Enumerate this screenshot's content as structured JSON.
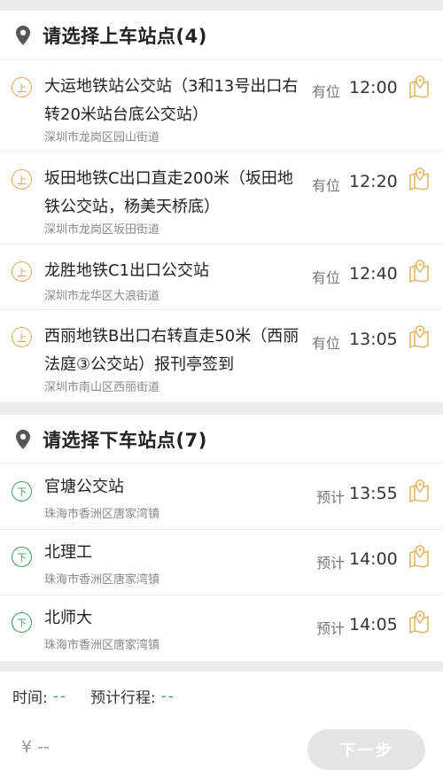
{
  "colors": {
    "accent_green": "#3aa060",
    "pickup_badge": "#d99a45",
    "map_icon": "#e0b868"
  },
  "pickup": {
    "title": "请选择上车站点(4)",
    "stops": [
      {
        "badge": "上",
        "name": "大运地铁站公交站（3和13号出口右转20米站台底公交站）",
        "address": "深圳市龙岗区园山街道",
        "tag": "有位",
        "time": "12:00"
      },
      {
        "badge": "上",
        "name": "坂田地铁C出口直走200米（坂田地铁公交站，杨美天桥底）",
        "address": "深圳市龙岗区坂田街道",
        "tag": "有位",
        "time": "12:20"
      },
      {
        "badge": "上",
        "name": "龙胜地铁C1出口公交站",
        "address": "深圳市龙华区大浪街道",
        "tag": "有位",
        "time": "12:40"
      },
      {
        "badge": "上",
        "name": "西丽地铁B出口右转直走50米（西丽法庭③公交站）报刊亭签到",
        "address": "深圳市南山区西丽街道",
        "tag": "有位",
        "time": "13:05"
      }
    ]
  },
  "dropoff": {
    "title": "请选择下车站点(7)",
    "stops": [
      {
        "badge": "下",
        "name": "官塘公交站",
        "address": "珠海市香洲区唐家湾镇",
        "tag": "预计",
        "time": "13:55"
      },
      {
        "badge": "下",
        "name": "北理工",
        "address": "珠海市香洲区唐家湾镇",
        "tag": "预计",
        "time": "14:00"
      },
      {
        "badge": "下",
        "name": "北师大",
        "address": "珠海市香洲区唐家湾镇",
        "tag": "预计",
        "time": "14:05"
      }
    ]
  },
  "summary": {
    "time_label": "时间:",
    "time_value": "--",
    "trip_label": "预计行程:",
    "trip_value": "--"
  },
  "footer": {
    "price": "¥ --",
    "next_label": "下一步"
  }
}
